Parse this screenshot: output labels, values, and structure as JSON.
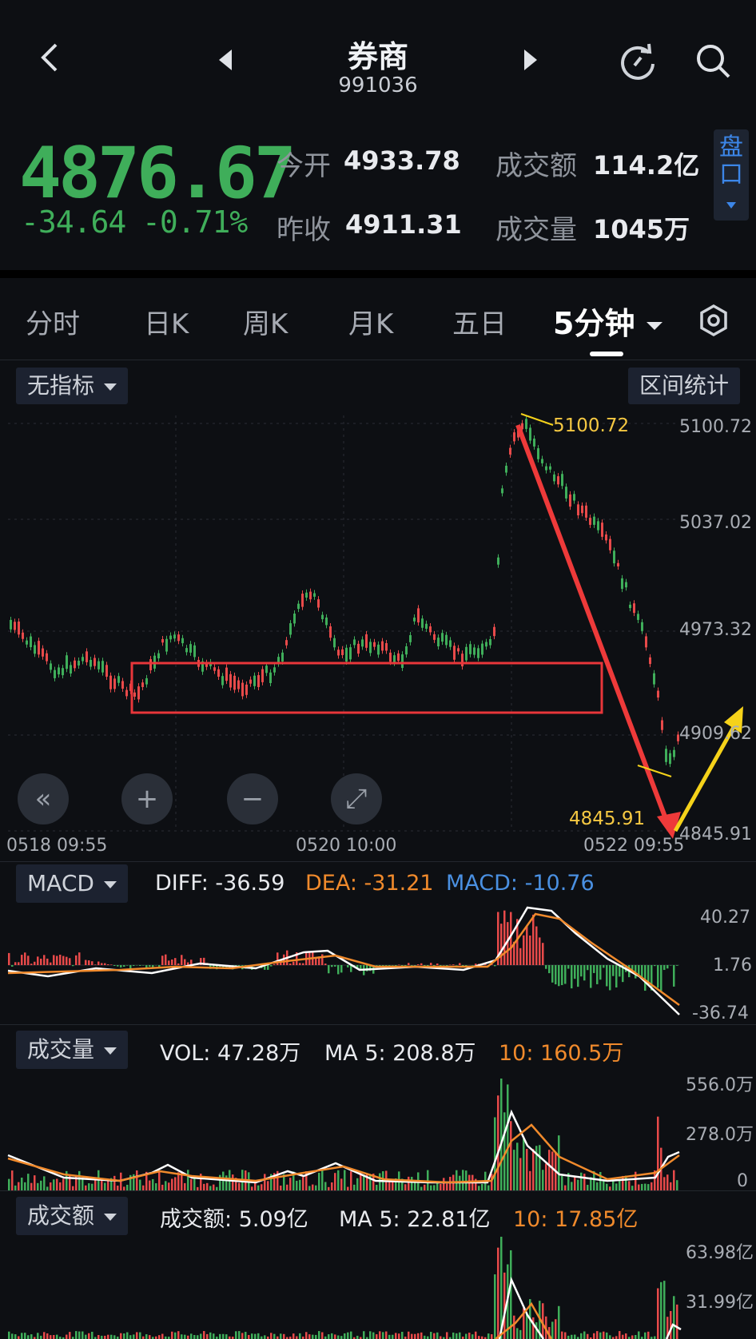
{
  "header": {
    "title": "券商",
    "code": "991036"
  },
  "quote": {
    "price": "4876.67",
    "change": "-34.64",
    "change_pct": "-0.71%",
    "open_label": "今开",
    "open_value": "4933.78",
    "prev_close_label": "昨收",
    "prev_close_value": "4911.31",
    "amount_label": "成交额",
    "amount_value": "114.2亿",
    "volume_label": "成交量",
    "volume_value": "1045万",
    "panel_button": "盘口"
  },
  "tabs": [
    {
      "label": "分时"
    },
    {
      "label": "日K"
    },
    {
      "label": "周K"
    },
    {
      "label": "月K"
    },
    {
      "label": "五日"
    },
    {
      "label": "5分钟",
      "active": true
    }
  ],
  "toolbar": {
    "indicator_select": "无指标",
    "range_stats": "区间统计"
  },
  "main_chart": {
    "y_ticks": [
      "5100.72",
      "5037.02",
      "4973.32",
      "4909.62",
      "4845.91"
    ],
    "high_label": "5100.72",
    "low_label": "4845.91",
    "x_ticks": [
      "0518 09:55",
      "0520 10:00",
      "0522 09:55"
    ],
    "controls": [
      "«",
      "+",
      "−",
      "⤢"
    ]
  },
  "macd": {
    "select": "MACD",
    "diff": "DIFF: -36.59",
    "dea": "DEA: -31.21",
    "macd": "MACD: -10.76",
    "y_ticks": [
      "40.27",
      "1.76",
      "-36.74"
    ]
  },
  "volume": {
    "select": "成交量",
    "vol": "VOL: 47.28万",
    "ma5": "MA 5: 208.8万",
    "ma10": "10: 160.5万",
    "y_ticks": [
      "556.0万",
      "278.0万",
      "0"
    ]
  },
  "amount": {
    "select": "成交额",
    "amt": "成交额: 5.09亿",
    "ma5": "MA 5: 22.81亿",
    "ma10": "10: 17.85亿",
    "y_ticks": [
      "63.98亿",
      "31.99亿"
    ]
  },
  "colors": {
    "up": "#e84a4a",
    "down": "#3fae5a",
    "dea": "#f08a2c",
    "macd": "#4a90e2",
    "accent_yellow": "#f5d21a"
  }
}
